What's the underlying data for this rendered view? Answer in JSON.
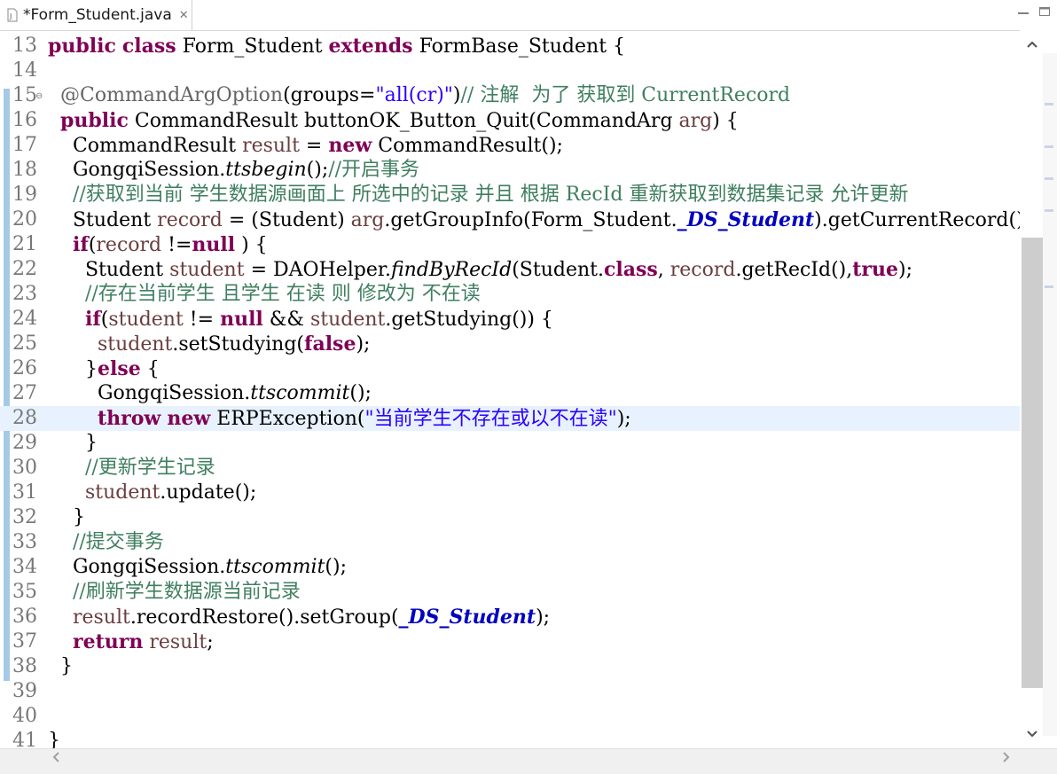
{
  "tab": {
    "title": "*Form_Student.java",
    "close": "✕"
  },
  "lines": [
    {
      "n": "13",
      "segs": [
        [
          "kw",
          "public"
        ],
        [
          "",
          " "
        ],
        [
          "kw",
          "class"
        ],
        [
          "",
          " Form_Student "
        ],
        [
          "kw",
          "extends"
        ],
        [
          "",
          " FormBase_Student {"
        ]
      ]
    },
    {
      "n": "14",
      "segs": []
    },
    {
      "n": "15",
      "fold": "⊖",
      "segs": [
        [
          "",
          "  "
        ],
        [
          "ann",
          "@CommandArgOption"
        ],
        [
          "",
          "(groups="
        ],
        [
          "str",
          "\"all(cr)\""
        ],
        [
          "",
          ")"
        ],
        [
          "cm",
          "// 注解  为了 获取到 CurrentRecord"
        ]
      ]
    },
    {
      "n": "16",
      "segs": [
        [
          "",
          "  "
        ],
        [
          "kw",
          "public"
        ],
        [
          "",
          " CommandResult buttonOK_Button_Quit(CommandArg "
        ],
        [
          "var",
          "arg"
        ],
        [
          "",
          ") {"
        ]
      ]
    },
    {
      "n": "17",
      "segs": [
        [
          "",
          "    CommandResult "
        ],
        [
          "var",
          "result"
        ],
        [
          "",
          " = "
        ],
        [
          "kw",
          "new"
        ],
        [
          "",
          " CommandResult();"
        ]
      ]
    },
    {
      "n": "18",
      "segs": [
        [
          "",
          "    GongqiSession."
        ],
        [
          "ital",
          "ttsbegin"
        ],
        [
          "",
          "();"
        ],
        [
          "cm",
          "//开启事务"
        ]
      ]
    },
    {
      "n": "19",
      "segs": [
        [
          "",
          "    "
        ],
        [
          "cm",
          "//获取到当前 学生数据源画面上 所选中的记录 并且 根据 RecId 重新获取到数据集记录 允许更新"
        ]
      ]
    },
    {
      "n": "20",
      "segs": [
        [
          "",
          "    Student "
        ],
        [
          "var",
          "record"
        ],
        [
          "",
          " = (Student) "
        ],
        [
          "var",
          "arg"
        ],
        [
          "",
          ".getGroupInfo(Form_Student."
        ],
        [
          "fld",
          "_DS_Student"
        ],
        [
          "",
          ").getCurrentRecord();"
        ]
      ]
    },
    {
      "n": "21",
      "segs": [
        [
          "",
          "    "
        ],
        [
          "kw",
          "if"
        ],
        [
          "",
          "("
        ],
        [
          "var",
          "record"
        ],
        [
          "",
          " !="
        ],
        [
          "kw",
          "null"
        ],
        [
          "",
          " ) {"
        ]
      ]
    },
    {
      "n": "22",
      "segs": [
        [
          "",
          "      Student "
        ],
        [
          "var",
          "student"
        ],
        [
          "",
          " = DAOHelper."
        ],
        [
          "ital",
          "findByRecId"
        ],
        [
          "",
          "(Student."
        ],
        [
          "kw",
          "class"
        ],
        [
          "",
          ", "
        ],
        [
          "var",
          "record"
        ],
        [
          "",
          ".getRecId(),"
        ],
        [
          "kw",
          "true"
        ],
        [
          "",
          ");"
        ]
      ]
    },
    {
      "n": "23",
      "segs": [
        [
          "",
          "      "
        ],
        [
          "cm",
          "//存在当前学生 且学生 在读 则 修改为 不在读"
        ]
      ]
    },
    {
      "n": "24",
      "segs": [
        [
          "",
          "      "
        ],
        [
          "kw",
          "if"
        ],
        [
          "",
          "("
        ],
        [
          "var",
          "student"
        ],
        [
          "",
          " != "
        ],
        [
          "kw",
          "null"
        ],
        [
          "",
          " && "
        ],
        [
          "var",
          "student"
        ],
        [
          "",
          ".getStudying()) {"
        ]
      ]
    },
    {
      "n": "25",
      "segs": [
        [
          "",
          "        "
        ],
        [
          "var",
          "student"
        ],
        [
          "",
          ".setStudying("
        ],
        [
          "kw",
          "false"
        ],
        [
          "",
          ");"
        ]
      ]
    },
    {
      "n": "26",
      "segs": [
        [
          "",
          "      }"
        ],
        [
          "kw",
          "else"
        ],
        [
          "",
          " {"
        ]
      ]
    },
    {
      "n": "27",
      "segs": [
        [
          "",
          "        GongqiSession."
        ],
        [
          "ital",
          "ttscommit"
        ],
        [
          "",
          "();"
        ]
      ]
    },
    {
      "n": "28",
      "current": true,
      "segs": [
        [
          "",
          "        "
        ],
        [
          "kw",
          "throw"
        ],
        [
          "",
          " "
        ],
        [
          "kw",
          "new"
        ],
        [
          "",
          " ERPException("
        ],
        [
          "str",
          "\"当前学生不存在或以不在读\""
        ],
        [
          "",
          ");"
        ]
      ]
    },
    {
      "n": "29",
      "segs": [
        [
          "",
          "      }"
        ]
      ]
    },
    {
      "n": "30",
      "segs": [
        [
          "",
          "      "
        ],
        [
          "cm",
          "//更新学生记录"
        ]
      ]
    },
    {
      "n": "31",
      "segs": [
        [
          "",
          "      "
        ],
        [
          "var",
          "student"
        ],
        [
          "",
          ".update();"
        ]
      ]
    },
    {
      "n": "32",
      "segs": [
        [
          "",
          "    }"
        ]
      ]
    },
    {
      "n": "33",
      "segs": [
        [
          "",
          "    "
        ],
        [
          "cm",
          "//提交事务"
        ]
      ]
    },
    {
      "n": "34",
      "segs": [
        [
          "",
          "    GongqiSession."
        ],
        [
          "ital",
          "ttscommit"
        ],
        [
          "",
          "();"
        ]
      ]
    },
    {
      "n": "35",
      "segs": [
        [
          "",
          "    "
        ],
        [
          "cm",
          "//刷新学生数据源当前记录"
        ]
      ]
    },
    {
      "n": "36",
      "segs": [
        [
          "",
          "    "
        ],
        [
          "var",
          "result"
        ],
        [
          "",
          ".recordRestore().setGroup("
        ],
        [
          "fld",
          "_DS_Student"
        ],
        [
          "",
          ");"
        ]
      ]
    },
    {
      "n": "37",
      "segs": [
        [
          "",
          "    "
        ],
        [
          "kw",
          "return"
        ],
        [
          "",
          " "
        ],
        [
          "var",
          "result"
        ],
        [
          "",
          ";"
        ]
      ]
    },
    {
      "n": "38",
      "segs": [
        [
          "",
          "  }"
        ]
      ]
    },
    {
      "n": "39",
      "segs": []
    },
    {
      "n": "40",
      "segs": []
    },
    {
      "n": "41",
      "segs": [
        [
          "",
          "}"
        ]
      ]
    }
  ],
  "colors": {
    "keyword": "#7f0055",
    "comment": "#3f7f5f",
    "string": "#2a00ff",
    "field": "#0000c0",
    "local": "#6a3e3e",
    "current_line": "#e8f2fe"
  },
  "icons": {
    "scroll_up": "▲",
    "scroll_down": "▼",
    "scroll_left": "‹",
    "scroll_right": "›"
  }
}
